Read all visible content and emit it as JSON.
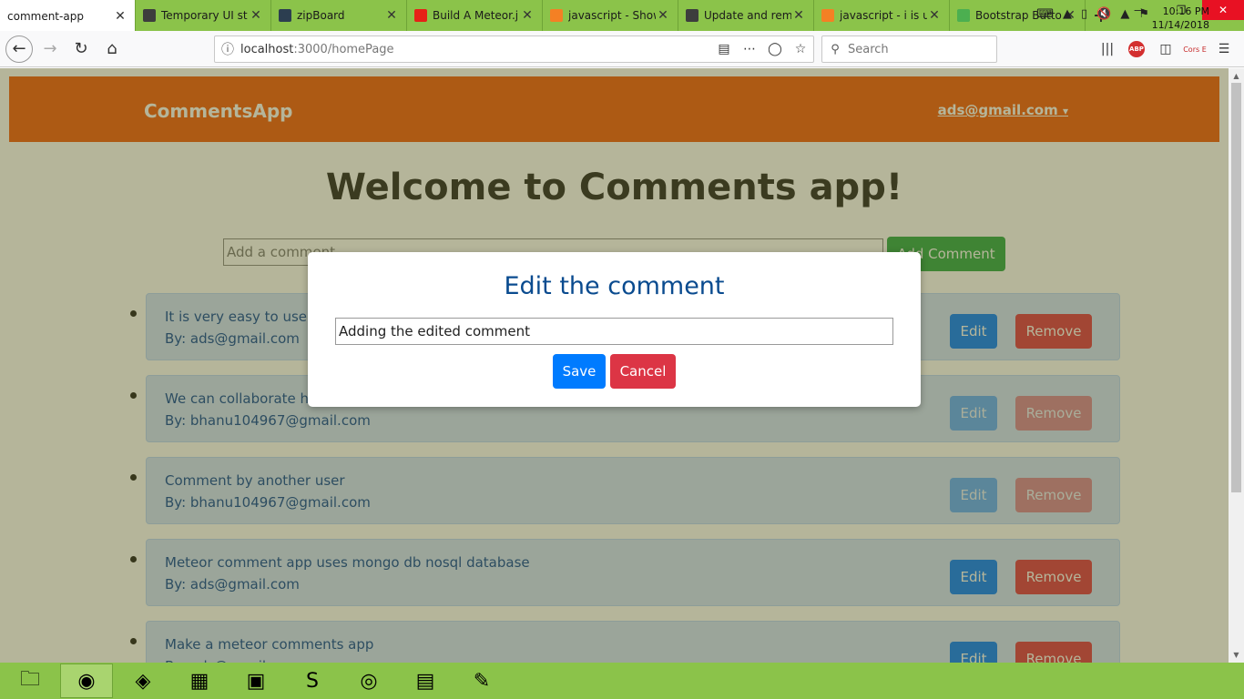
{
  "browser": {
    "tabs": [
      {
        "label": "comment-app",
        "active": true,
        "favicon": "none"
      },
      {
        "label": "Temporary UI st",
        "active": false,
        "favicon": "meteor-icon"
      },
      {
        "label": "zipBoard",
        "active": false,
        "favicon": "zipboard-icon"
      },
      {
        "label": "Build A Meteor.j",
        "active": false,
        "favicon": "youtube-icon"
      },
      {
        "label": "javascript - Show",
        "active": false,
        "favicon": "stackoverflow-icon"
      },
      {
        "label": "Update and remo",
        "active": false,
        "favicon": "meteor-icon"
      },
      {
        "label": "javascript - i is u",
        "active": false,
        "favicon": "stackoverflow-icon"
      },
      {
        "label": "Bootstrap Button",
        "active": false,
        "favicon": "w3schools-icon"
      }
    ],
    "url_host": "localhost",
    "url_rest": ":3000/homePage",
    "search_placeholder": "Search",
    "abp_label": "ABP",
    "cors_label": "Cors E"
  },
  "app": {
    "brand": "CommentsApp",
    "user": "ads@gmail.com",
    "user_caret": "▾",
    "welcome": "Welcome to Comments app!",
    "add_placeholder": "Add a comment",
    "add_button": "Add Comment",
    "edit_label": "Edit",
    "remove_label": "Remove",
    "comments": [
      {
        "text": "It is very easy to use.",
        "by": "By: ads@gmail.com",
        "muted": false
      },
      {
        "text": "We can collaborate here",
        "by": "By: bhanu104967@gmail.com",
        "muted": true
      },
      {
        "text": "Comment by another user",
        "by": "By: bhanu104967@gmail.com",
        "muted": true
      },
      {
        "text": "Meteor comment app uses mongo db nosql database",
        "by": "By: ads@gmail.com",
        "muted": false
      },
      {
        "text": "Make a meteor comments app",
        "by": "By: ads@gmail.com",
        "muted": false
      }
    ]
  },
  "modal": {
    "title": "Edit the comment",
    "value": "Adding the edited comment",
    "save": "Save",
    "cancel": "Cancel"
  },
  "taskbar": {
    "items": [
      "file-explorer-icon",
      "firefox-icon",
      "virtualbox-icon",
      "winrar-icon",
      "terminal-icon",
      "sublime-text-icon",
      "chrome-icon",
      "notepad-icon",
      "notepadplusplus-icon"
    ],
    "time": "10:16 PM",
    "date": "11/14/2018"
  },
  "colors": {
    "tabstrip": "#8bc34a",
    "app_navbar": "#f05a0c",
    "comment_bg": "#cfe2ff",
    "primary": "#007bff",
    "danger": "#dc3545",
    "success": "#28a745"
  }
}
